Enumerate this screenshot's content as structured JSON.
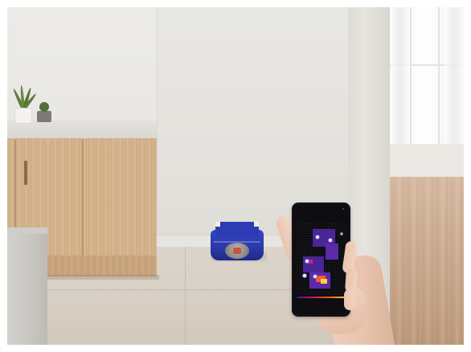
{
  "scene": {
    "subject": "robot-vacuum-in-kitchen-with-phone-app",
    "colors": {
      "robot_blue": "#2d3cb5",
      "cabinet_wood": "#d5b58f",
      "wall": "#e9e8e4",
      "floor": "#d8d0c5",
      "map_purple": "#5a2aa8",
      "map_hot": "#ff5a2a"
    }
  },
  "phone_app": {
    "title": "",
    "tab_left": "",
    "tab_right": "",
    "sub_left": "",
    "sub_right": "",
    "close_icon": "close-icon",
    "stats": [
      {
        "value": "",
        "label": ""
      },
      {
        "value": "",
        "label": ""
      },
      {
        "value": "",
        "label": ""
      }
    ]
  }
}
